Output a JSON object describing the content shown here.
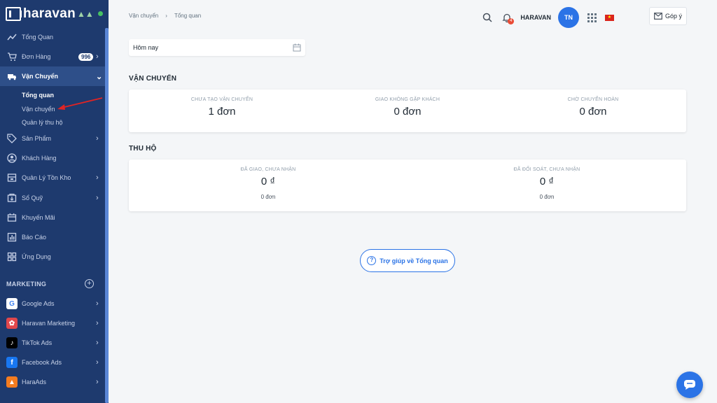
{
  "sidebar": {
    "logo_text": "haravan",
    "nav": [
      {
        "label": "Tổng Quan",
        "icon": "trend-line-icon"
      },
      {
        "label": "Đơn Hàng",
        "icon": "cart-icon",
        "badge": "996"
      },
      {
        "label": "Vận Chuyển",
        "icon": "truck-icon"
      },
      {
        "label": "Sản Phẩm",
        "icon": "tag-icon"
      },
      {
        "label": "Khách Hàng",
        "icon": "user-circle-icon"
      },
      {
        "label": "Quản Lý Tồn Kho",
        "icon": "inventory-icon"
      },
      {
        "label": "Sổ Quỹ",
        "icon": "cashbook-icon"
      },
      {
        "label": "Khuyến Mãi",
        "icon": "promotion-icon"
      },
      {
        "label": "Báo Cáo",
        "icon": "report-icon"
      },
      {
        "label": "Ứng Dụng",
        "icon": "apps-icon"
      }
    ],
    "sub_items": [
      {
        "label": "Tổng quan"
      },
      {
        "label": "Vận chuyển"
      },
      {
        "label": "Quản lý thu hộ"
      }
    ],
    "marketing_label": "MARKETING",
    "apps": [
      {
        "label": "Google Ads",
        "icon": "google-icon"
      },
      {
        "label": "Haravan Marketing",
        "icon": "haravan-marketing-icon"
      },
      {
        "label": "TikTok Ads",
        "icon": "tiktok-icon"
      },
      {
        "label": "Facebook Ads",
        "icon": "facebook-icon"
      },
      {
        "label": "HaraAds",
        "icon": "haraads-icon"
      }
    ]
  },
  "header": {
    "breadcrumb": [
      "Vận chuyển",
      "Tổng quan"
    ],
    "store_name": "HARAVAN",
    "avatar_initials": "TN",
    "notification_count": "4",
    "feedback_label": "Góp ý"
  },
  "date_filter": {
    "value": "Hôm nay"
  },
  "shipping_section": {
    "title": "VẬN CHUYỂN",
    "stats": [
      {
        "label": "CHƯA TẠO VẬN CHUYỂN",
        "value": "1 đơn"
      },
      {
        "label": "GIAO KHÔNG GẶP KHÁCH",
        "value": "0 đơn"
      },
      {
        "label": "CHỜ CHUYỂN HOÀN",
        "value": "0 đơn"
      }
    ]
  },
  "cod_section": {
    "title": "THU HỘ",
    "stats": [
      {
        "label": "ĐÃ GIAO, CHƯA NHẬN",
        "value": "0 ₫",
        "sub": "0 đơn"
      },
      {
        "label": "ĐÃ ĐỐI SOÁT, CHƯA NHẬN",
        "value": "0 ₫",
        "sub": "0 đơn"
      }
    ]
  },
  "help_button": {
    "label": "Trợ giúp về Tổng quan"
  },
  "colors": {
    "sidebar_bg": "#1e3a6e",
    "accent": "#2b73e6",
    "annotation": "#e02424"
  }
}
